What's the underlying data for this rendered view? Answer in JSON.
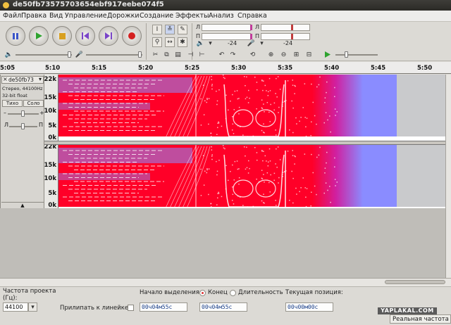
{
  "window": {
    "title": "de50fb73575703654ebf917eebe074f5"
  },
  "menu": [
    "Файл",
    "Правка",
    "Вид",
    "Управление",
    "Дорожки",
    "Создание",
    "Эффекты",
    "Анализ",
    "Справка"
  ],
  "transport": {
    "pause_icon": "pause-icon",
    "play_icon": "play-icon",
    "stop_icon": "stop-icon",
    "skip_start_icon": "skip-start-icon",
    "skip_end_icon": "skip-end-icon",
    "record_icon": "record-icon"
  },
  "meters": {
    "playback_db": "-24",
    "record_db": "-24",
    "l": "Л",
    "p": "П"
  },
  "ruler": {
    "ticks": [
      "5:05",
      "5:10",
      "5:15",
      "5:20",
      "5:25",
      "5:30",
      "5:35",
      "5:40",
      "5:45",
      "5:50"
    ]
  },
  "track": {
    "name": "de50fb73",
    "info_line1": "Стерео, 44100Hz",
    "info_line2": "32-bit float",
    "mute": "Тихо",
    "solo": "Соло",
    "pan_l": "Л",
    "pan_r": "П"
  },
  "freq_labels": [
    "22k",
    "15k",
    "10k",
    "5k",
    "0k"
  ],
  "selection_bar": {
    "project_rate_label": "Частота проекта",
    "hz_label": "(Гц):",
    "project_rate": "44100",
    "snap_label": "Прилипать к линейке",
    "sel_start_label": "Начало выделения:",
    "end_label": "Конец",
    "length_label": "Длительность",
    "cur_pos_label": "Текущая позиция:",
    "sel_start": "00ч04м55с",
    "sel_end": "00ч04м55с",
    "cur_pos": "00ч00м00с"
  },
  "status": {
    "right": "Реальная частота"
  },
  "watermark": "YAPLAKAL.COM",
  "colors": {
    "spectro_hot": "#ff0028",
    "spectro_mid": "#d020a0",
    "spectro_cool": "#8a8cff",
    "spectro_idle": "#c9cacc"
  }
}
